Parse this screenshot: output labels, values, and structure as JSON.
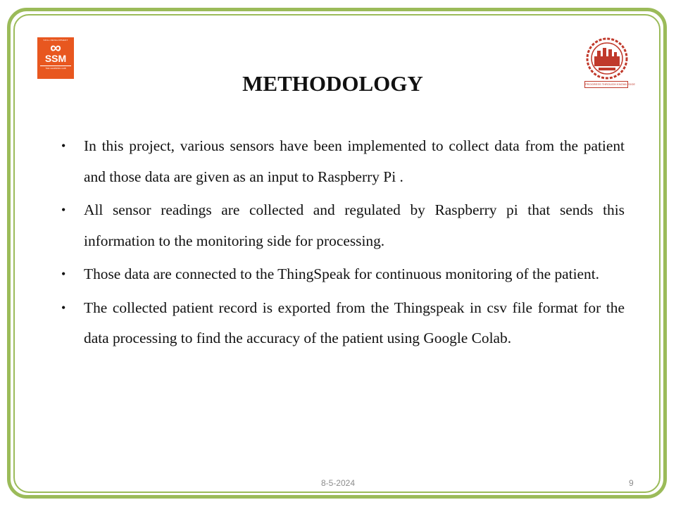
{
  "slide": {
    "title": "METHODOLOGY",
    "bullets": [
      " In this project, various sensors have been implemented to collect data from the patient and those data are given as an input to  Raspberry Pi .",
      " All sensor readings are collected and regulated by Raspberry pi that sends this information to the monitoring side for processing.",
      " Those data are connected to the ThingSpeak  for continuous monitoring of the patient.",
      " The collected patient record is exported from the Thingspeak in csv file format for the data processing to find the accuracy of the patient using Google Colab."
    ],
    "bullet_symbol": "•"
  },
  "logos": {
    "left": {
      "top_text": "SKILL DEVELOPMENT",
      "symbol": "∞",
      "name": "SSM",
      "tagline": "THE LEARNING HUB"
    },
    "right": {
      "caption": "PROGRESS THROUGH KNOWLEDGE"
    }
  },
  "footer": {
    "date": "8-5-2024",
    "page": "9"
  },
  "colors": {
    "frame": "#9bbb59",
    "logo_left": "#e8571f",
    "logo_right": "#c0392b"
  }
}
